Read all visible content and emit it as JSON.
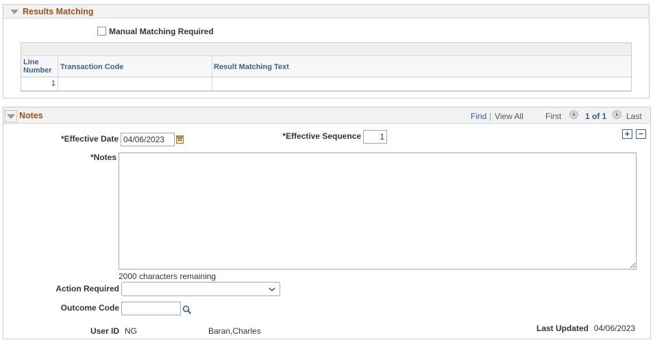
{
  "results_matching": {
    "title": "Results Matching",
    "manual_matching_label": "Manual Matching Required",
    "manual_matching_checked": false,
    "grid": {
      "columns": [
        "Line Number",
        "Transaction Code",
        "Result Matching Text"
      ],
      "col_line_1": "Line",
      "col_line_2": "Number",
      "rows": [
        {
          "line": "1",
          "transaction_code": "",
          "result_text": ""
        }
      ]
    }
  },
  "notes": {
    "title": "Notes",
    "nav": {
      "find": "Find",
      "separator": "|",
      "view_all": "View All",
      "first": "First",
      "counter": "1 of 1",
      "last": "Last"
    },
    "effective_date_label": "*Effective Date",
    "effective_date_value": "04/06/2023",
    "effective_sequence_label": "*Effective Sequence",
    "effective_sequence_value": "1",
    "notes_label": "*Notes",
    "notes_value": "",
    "chars_remaining": "2000 characters remaining",
    "action_required_label": "Action Required",
    "action_required_value": "",
    "outcome_code_label": "Outcome Code",
    "outcome_code_value": "",
    "user_id_label": "User ID",
    "user_id_value": "NG",
    "user_name": "Baran,Charles",
    "last_updated_label": "Last Updated",
    "last_updated_value": "04/06/2023",
    "add_button": "+",
    "delete_button": "−"
  },
  "icons": {
    "calendar": "calendar-icon",
    "lookup": "search-icon",
    "dropdown": "chevron-down-icon"
  },
  "colors": {
    "section_title": "#a04f17",
    "grid_header": "#3d5f8f",
    "link": "#2e5d9a",
    "header_bg": "#f2f2f2"
  }
}
